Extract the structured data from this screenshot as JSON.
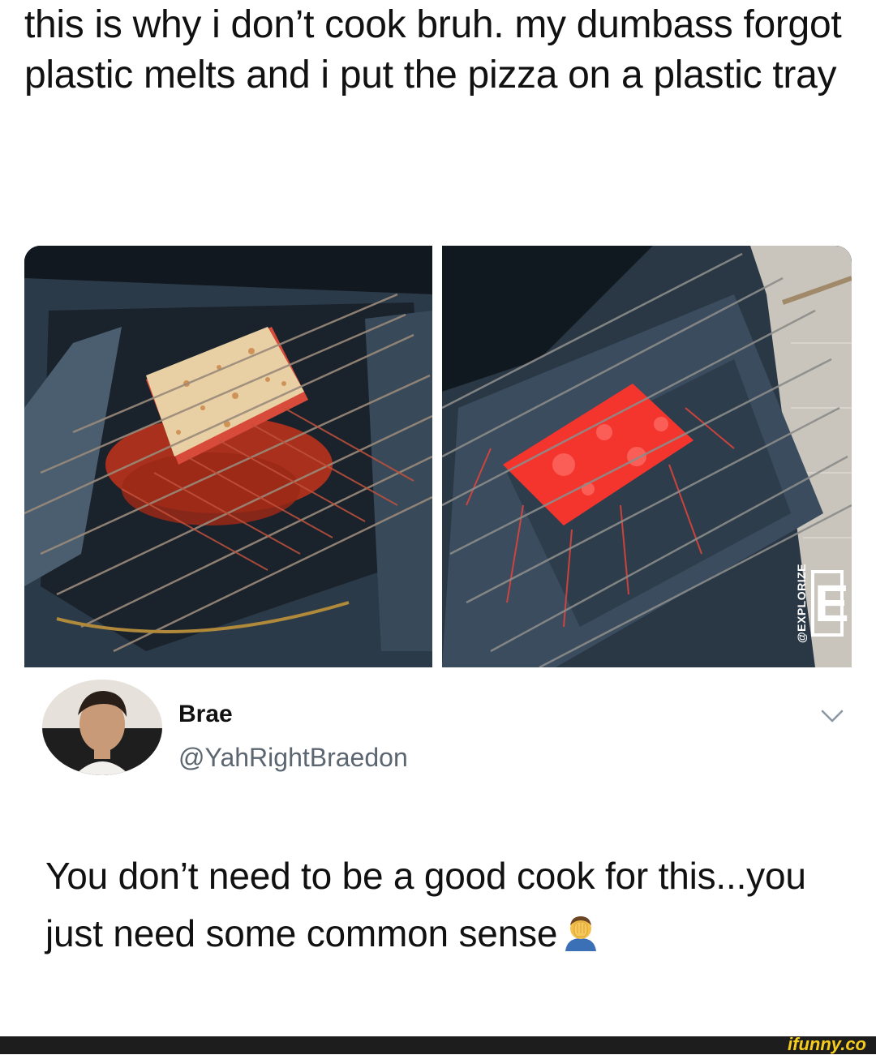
{
  "post": {
    "text": "this is why i don’t cook bruh. my dumbass forgot plastic melts and i put the pizza on a plastic tray"
  },
  "photos": {
    "watermark": {
      "text": "@EXPLORIZE",
      "logo_letter": "E"
    }
  },
  "reply": {
    "author_name": "Brae",
    "author_handle": "@YahRightBraedon",
    "text": "You don’t need to be a good cook for this...you just need some common sense",
    "emoji": "man-facepalming-icon"
  },
  "footer": {
    "site_logo": "ifunny.co"
  },
  "colors": {
    "text": "#111111",
    "handle": "#5b6670",
    "footer_bg": "#1d1d1d",
    "logo_yellow": "#f6cc1d",
    "melted_plastic": "#e8362c"
  }
}
